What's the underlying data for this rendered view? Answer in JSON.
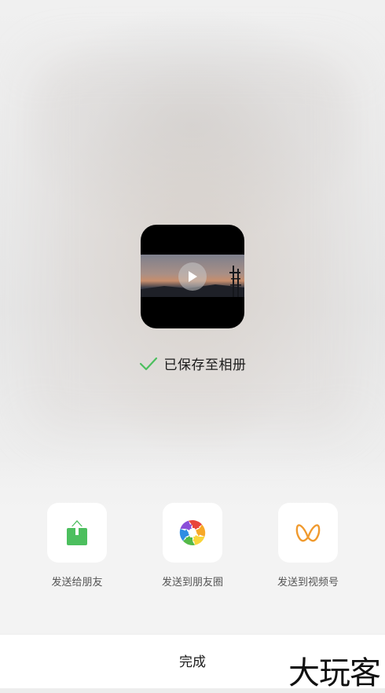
{
  "preview": {
    "saved_status": "已保存至相册"
  },
  "share": {
    "items": [
      {
        "label": "发送给朋友",
        "icon": "share-to-friend-icon",
        "color": "#4cbf5e"
      },
      {
        "label": "发送到朋友圈",
        "icon": "moments-aperture-icon",
        "color": "multicolor"
      },
      {
        "label": "发送到视频号",
        "icon": "channels-butterfly-icon",
        "color": "#f09a2e"
      }
    ]
  },
  "footer": {
    "done_label": "完成",
    "watermark": "大玩客"
  },
  "colors": {
    "check": "#4cbf5e",
    "background": "#ededed",
    "footer_bg": "#ffffff"
  }
}
